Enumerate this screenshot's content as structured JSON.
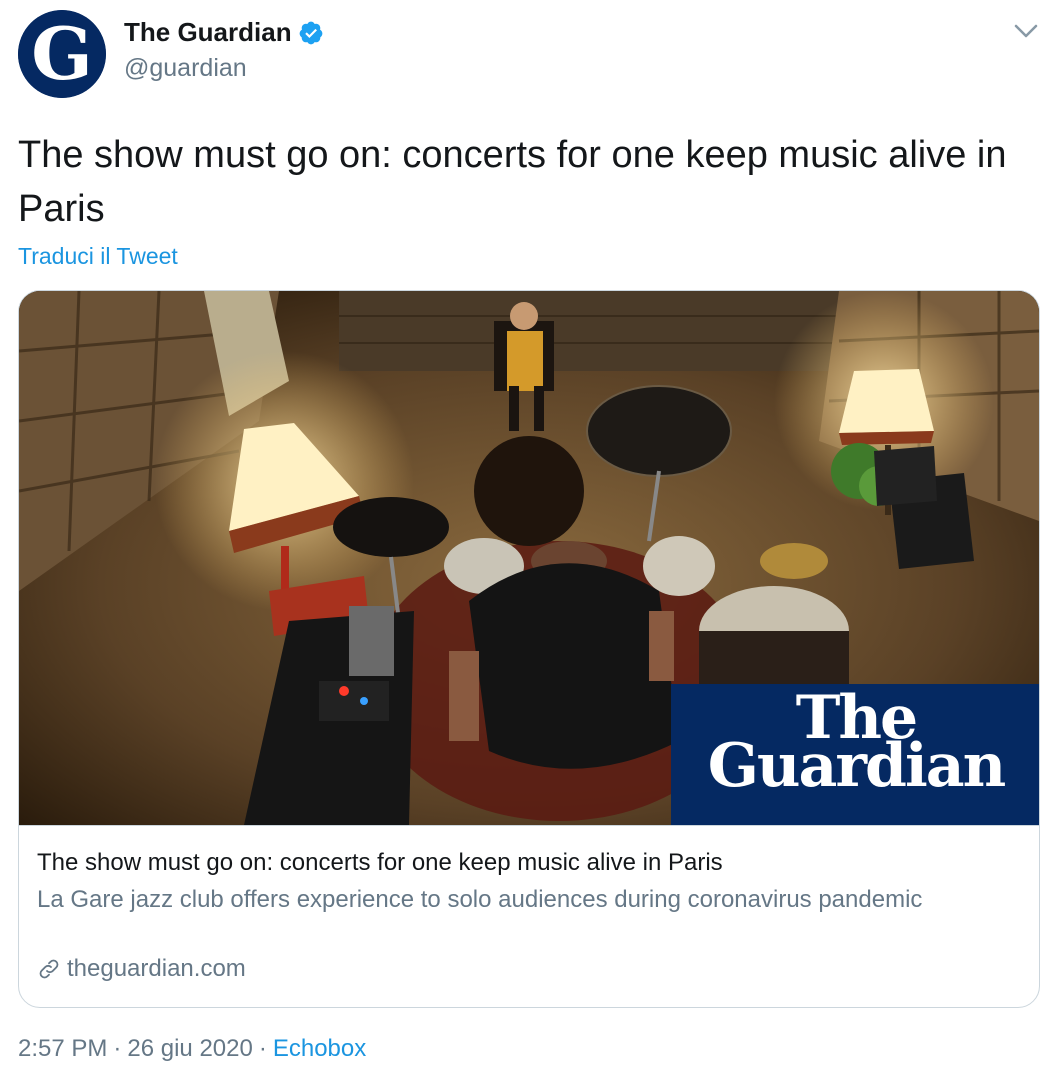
{
  "author": {
    "display_name": "The Guardian",
    "handle": "@guardian",
    "verified": true,
    "avatar_icon": "guardian-g-logo",
    "avatar_color": "#052962"
  },
  "tweet": {
    "text": "The show must go on: concerts for one keep music alive in Paris",
    "translate_label": "Traduci il Tweet"
  },
  "card": {
    "image_alt": "Drummer playing for a single audience member in a stone cellar jazz club",
    "brand_line1": "The",
    "brand_line2": "Guardian",
    "brand_color": "#052962",
    "title": "The show must go on: concerts for one keep music alive in Paris",
    "description": "La Gare jazz club offers experience to solo audiences during coronavirus pandemic",
    "domain": "theguardian.com",
    "domain_icon": "link-icon"
  },
  "meta": {
    "time": "2:57 PM",
    "separator": "·",
    "date": "26 giu 2020",
    "source": "Echobox"
  },
  "colors": {
    "accent": "#1b95e0",
    "secondary_text": "#657786",
    "border": "#ccd6dd"
  }
}
